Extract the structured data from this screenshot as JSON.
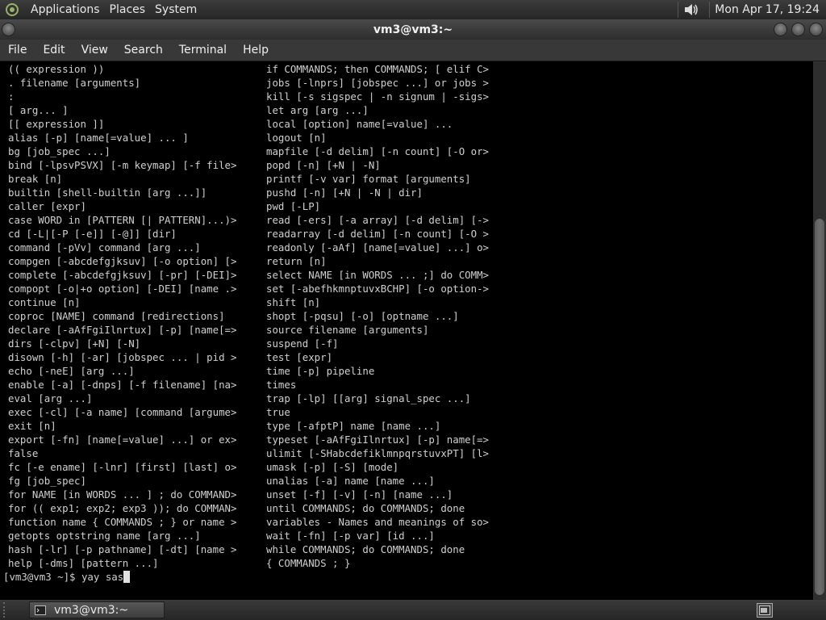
{
  "top_panel": {
    "menus": [
      "Applications",
      "Places",
      "System"
    ],
    "clock": "Mon Apr 17, 19:24"
  },
  "window": {
    "title": "vm3@vm3:~"
  },
  "menubar": [
    "File",
    "Edit",
    "View",
    "Search",
    "Terminal",
    "Help"
  ],
  "terminal": {
    "left_column": [
      "(( expression ))",
      ". filename [arguments]",
      ":",
      "[ arg... ]",
      "[[ expression ]]",
      "alias [-p] [name[=value] ... ]",
      "bg [job_spec ...]",
      "bind [-lpsvPSVX] [-m keymap] [-f file>",
      "break [n]",
      "builtin [shell-builtin [arg ...]]",
      "caller [expr]",
      "case WORD in [PATTERN [| PATTERN]...)>",
      "cd [-L|[-P [-e]] [-@]] [dir]",
      "command [-pVv] command [arg ...]",
      "compgen [-abcdefgjksuv] [-o option] [>",
      "complete [-abcdefgjksuv] [-pr] [-DEI]>",
      "compopt [-o|+o option] [-DEI] [name .>",
      "continue [n]",
      "coproc [NAME] command [redirections]",
      "declare [-aAfFgiIlnrtux] [-p] [name[=>",
      "dirs [-clpv] [+N] [-N]",
      "disown [-h] [-ar] [jobspec ... | pid >",
      "echo [-neE] [arg ...]",
      "enable [-a] [-dnps] [-f filename] [na>",
      "eval [arg ...]",
      "exec [-cl] [-a name] [command [argume>",
      "exit [n]",
      "export [-fn] [name[=value] ...] or ex>",
      "false",
      "fc [-e ename] [-lnr] [first] [last] o>",
      "fg [job_spec]",
      "for NAME [in WORDS ... ] ; do COMMAND>",
      "for (( exp1; exp2; exp3 )); do COMMAN>",
      "function name { COMMANDS ; } or name >",
      "getopts optstring name [arg ...]",
      "hash [-lr] [-p pathname] [-dt] [name >",
      "help [-dms] [pattern ...]"
    ],
    "right_column": [
      "if COMMANDS; then COMMANDS; [ elif C>",
      "jobs [-lnprs] [jobspec ...] or jobs >",
      "kill [-s sigspec | -n signum | -sigs>",
      "let arg [arg ...]",
      "local [option] name[=value] ...",
      "logout [n]",
      "mapfile [-d delim] [-n count] [-O or>",
      "popd [-n] [+N | -N]",
      "printf [-v var] format [arguments]",
      "pushd [-n] [+N | -N | dir]",
      "pwd [-LP]",
      "read [-ers] [-a array] [-d delim] [->",
      "readarray [-d delim] [-n count] [-O >",
      "readonly [-aAf] [name[=value] ...] o>",
      "return [n]",
      "select NAME [in WORDS ... ;] do COMM>",
      "set [-abefhkmnptuvxBCHP] [-o option->",
      "shift [n]",
      "shopt [-pqsu] [-o] [optname ...]",
      "source filename [arguments]",
      "suspend [-f]",
      "test [expr]",
      "time [-p] pipeline",
      "times",
      "trap [-lp] [[arg] signal_spec ...]",
      "true",
      "type [-afptP] name [name ...]",
      "typeset [-aAfFgiIlnrtux] [-p] name[=>",
      "ulimit [-SHabcdefiklmnpqrstuvxPT] [l>",
      "umask [-p] [-S] [mode]",
      "unalias [-a] name [name ...]",
      "unset [-f] [-v] [-n] [name ...]",
      "until COMMANDS; do COMMANDS; done",
      "variables - Names and meanings of so>",
      "wait [-fn] [-p var] [id ...]",
      "while COMMANDS; do COMMANDS; done",
      "{ COMMANDS ; }"
    ],
    "prompt": "[vm3@vm3 ~]$ yay sas"
  },
  "taskbar": {
    "task_label": "vm3@vm3:~"
  }
}
